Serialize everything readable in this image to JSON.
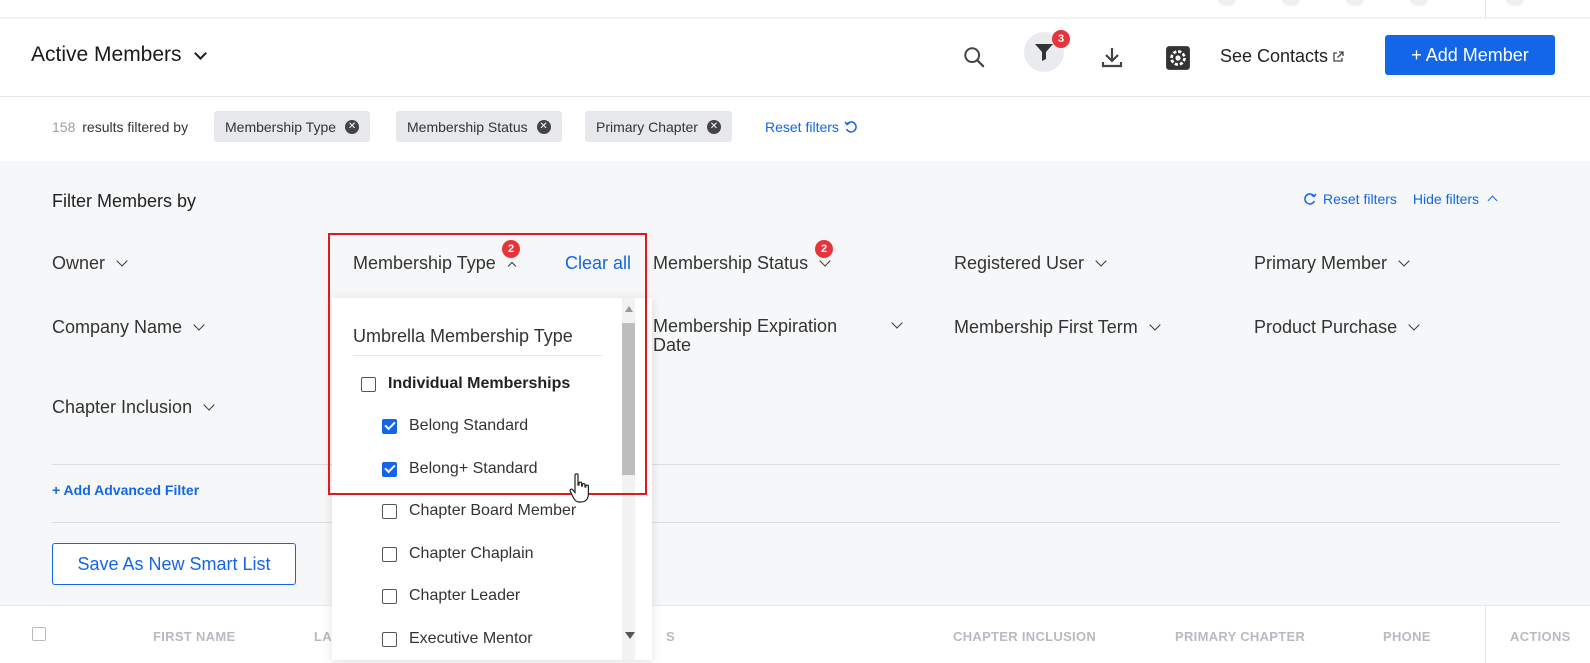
{
  "header": {
    "title": "Active Members",
    "filter_count": "3",
    "see_contacts": "See Contacts",
    "add_member": "+ Add Member"
  },
  "results": {
    "count": "158",
    "text": "results filtered by",
    "chips": [
      "Membership Type",
      "Membership Status",
      "Primary Chapter"
    ],
    "reset_filters": "Reset filters"
  },
  "panel": {
    "title": "Filter Members by",
    "reset_filters": "Reset filters",
    "hide_filters": "Hide filters",
    "filters": {
      "owner": "Owner",
      "membership_type": "Membership Type",
      "membership_type_badge": "2",
      "clear_all": "Clear all",
      "membership_status": "Membership Status",
      "membership_status_badge": "2",
      "registered_user": "Registered User",
      "primary_member": "Primary Member",
      "company_name": "Company Name",
      "membership_expiration_date_line1": "Membership Expiration",
      "membership_expiration_date_line2": "Date",
      "membership_first_term": "Membership First Term",
      "product_purchase": "Product Purchase",
      "chapter_inclusion": "Chapter Inclusion"
    },
    "add_advanced_filter": "+ Add Advanced Filter",
    "save_smart_list": "Save As New Smart List"
  },
  "dropdown": {
    "header": "Umbrella Membership Type",
    "options": [
      {
        "label": "Individual Memberships",
        "checked": false
      },
      {
        "label": "Belong Standard",
        "checked": true
      },
      {
        "label": "Belong+ Standard",
        "checked": true
      },
      {
        "label": "Chapter Board Member",
        "checked": false
      },
      {
        "label": "Chapter Chaplain",
        "checked": false
      },
      {
        "label": "Chapter Leader",
        "checked": false
      },
      {
        "label": "Executive Mentor",
        "checked": false
      }
    ]
  },
  "table": {
    "columns": [
      "FIRST NAME",
      "LA",
      "S",
      "CHAPTER INCLUSION",
      "PRIMARY CHAPTER",
      "PHONE",
      "ACTIONS"
    ]
  },
  "colors": {
    "accent": "#1366e8",
    "badge": "#e5343a",
    "highlight": "#e0191e"
  }
}
